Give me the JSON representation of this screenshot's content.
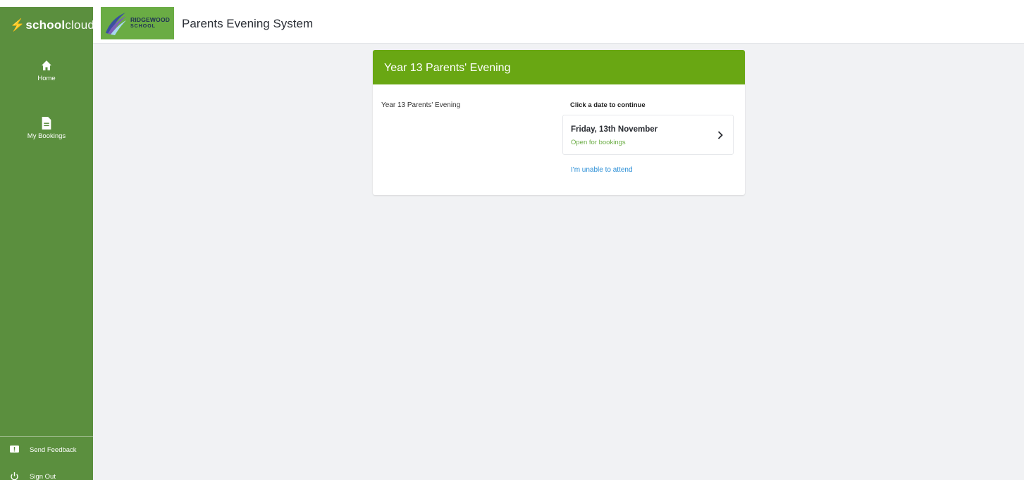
{
  "header": {
    "brand": {
      "part1": "school",
      "part2": "cloud"
    },
    "school_logo": {
      "line1": "RIDGEWOOD",
      "line2": "SCHOOL"
    },
    "app_title": "Parents Evening System"
  },
  "sidebar": {
    "items": [
      {
        "label": "Home",
        "icon": "home-icon"
      },
      {
        "label": "My Bookings",
        "icon": "document-icon"
      }
    ],
    "bottom": [
      {
        "label": "Send Feedback",
        "icon": "feedback-icon"
      },
      {
        "label": "Sign Out",
        "icon": "power-icon"
      }
    ]
  },
  "card": {
    "title": "Year 13 Parents' Evening",
    "event_name": "Year 13 Parents' Evening",
    "prompt": "Click a date to continue",
    "date": {
      "label": "Friday, 13th November",
      "status": "Open for bookings"
    },
    "unable_link": "I'm unable to attend"
  },
  "colors": {
    "sidebar_green": "#5b8f3e",
    "header_green": "#69a713",
    "status_green": "#6aac44",
    "link_blue": "#2a8ed6",
    "page_background": "#f1f2f4"
  }
}
